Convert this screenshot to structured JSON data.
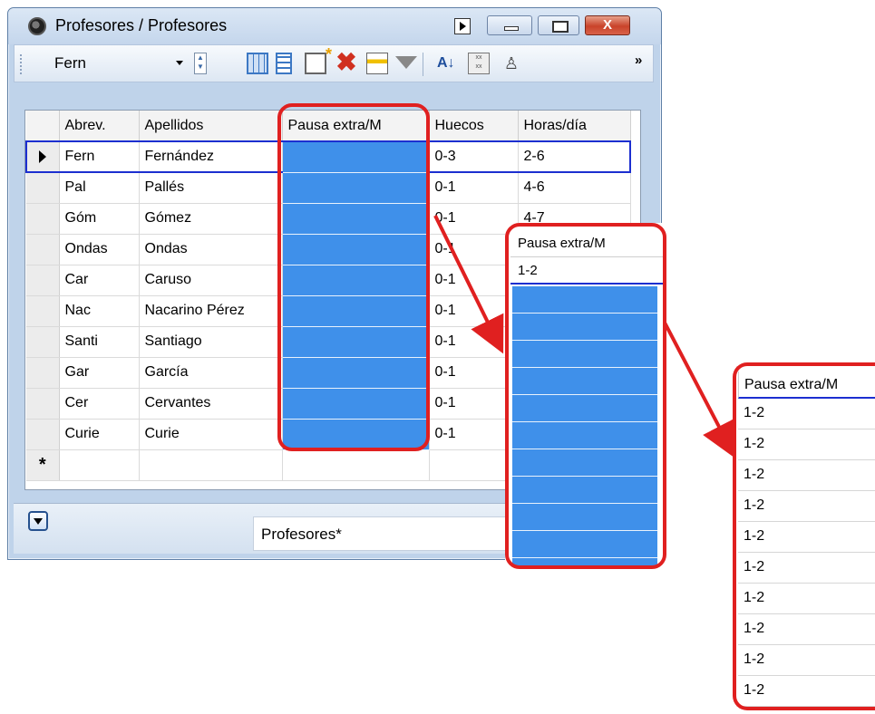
{
  "window": {
    "title": "Profesores / Profesores",
    "close_glyph": "X"
  },
  "toolbar": {
    "combo_value": "Fern",
    "more_glyph": "»"
  },
  "grid": {
    "columns": [
      "Abrev.",
      "Apellidos",
      "Pausa extra/M",
      "Huecos",
      "Horas/día"
    ],
    "rows": [
      {
        "abrev": "Fern",
        "apellidos": "Fernández",
        "huecos": "0-3",
        "horas": "2-6"
      },
      {
        "abrev": "Pal",
        "apellidos": "Pallés",
        "huecos": "0-1",
        "horas": "4-6"
      },
      {
        "abrev": "Góm",
        "apellidos": "Gómez",
        "huecos": "0-1",
        "horas": "4-7"
      },
      {
        "abrev": "Ondas",
        "apellidos": "Ondas",
        "huecos": "0-1",
        "horas": ""
      },
      {
        "abrev": "Car",
        "apellidos": "Caruso",
        "huecos": "0-1",
        "horas": ""
      },
      {
        "abrev": "Nac",
        "apellidos": "Nacarino Pérez",
        "huecos": "0-1",
        "horas": ""
      },
      {
        "abrev": "Santi",
        "apellidos": "Santiago",
        "huecos": "0-1",
        "horas": ""
      },
      {
        "abrev": "Gar",
        "apellidos": "García",
        "huecos": "0-1",
        "horas": ""
      },
      {
        "abrev": "Cer",
        "apellidos": "Cervantes",
        "huecos": "0-1",
        "horas": ""
      },
      {
        "abrev": "Curie",
        "apellidos": "Curie",
        "huecos": "0-1",
        "horas": ""
      }
    ],
    "new_row_marker": "*"
  },
  "status": {
    "field_text": "Profesores*"
  },
  "zoom1": {
    "header": "Pausa extra/M",
    "value": "1-2"
  },
  "zoom2": {
    "header": "Pausa extra/M",
    "values": [
      "1-2",
      "1-2",
      "1-2",
      "1-2",
      "1-2",
      "1-2",
      "1-2",
      "1-2",
      "1-2",
      "1-2"
    ]
  },
  "colors": {
    "highlight": "#3f90ea",
    "frame": "#e02020",
    "selection": "#1c2fd0"
  }
}
